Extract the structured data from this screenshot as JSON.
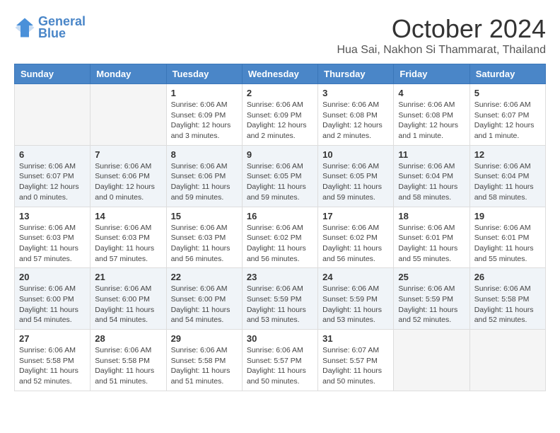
{
  "header": {
    "logo_line1": "General",
    "logo_line2": "Blue",
    "month_year": "October 2024",
    "location": "Hua Sai, Nakhon Si Thammarat, Thailand"
  },
  "weekdays": [
    "Sunday",
    "Monday",
    "Tuesday",
    "Wednesday",
    "Thursday",
    "Friday",
    "Saturday"
  ],
  "weeks": [
    [
      {
        "day": "",
        "info": ""
      },
      {
        "day": "",
        "info": ""
      },
      {
        "day": "1",
        "info": "Sunrise: 6:06 AM\nSunset: 6:09 PM\nDaylight: 12 hours\nand 3 minutes."
      },
      {
        "day": "2",
        "info": "Sunrise: 6:06 AM\nSunset: 6:09 PM\nDaylight: 12 hours\nand 2 minutes."
      },
      {
        "day": "3",
        "info": "Sunrise: 6:06 AM\nSunset: 6:08 PM\nDaylight: 12 hours\nand 2 minutes."
      },
      {
        "day": "4",
        "info": "Sunrise: 6:06 AM\nSunset: 6:08 PM\nDaylight: 12 hours\nand 1 minute."
      },
      {
        "day": "5",
        "info": "Sunrise: 6:06 AM\nSunset: 6:07 PM\nDaylight: 12 hours\nand 1 minute."
      }
    ],
    [
      {
        "day": "6",
        "info": "Sunrise: 6:06 AM\nSunset: 6:07 PM\nDaylight: 12 hours\nand 0 minutes."
      },
      {
        "day": "7",
        "info": "Sunrise: 6:06 AM\nSunset: 6:06 PM\nDaylight: 12 hours\nand 0 minutes."
      },
      {
        "day": "8",
        "info": "Sunrise: 6:06 AM\nSunset: 6:06 PM\nDaylight: 11 hours\nand 59 minutes."
      },
      {
        "day": "9",
        "info": "Sunrise: 6:06 AM\nSunset: 6:05 PM\nDaylight: 11 hours\nand 59 minutes."
      },
      {
        "day": "10",
        "info": "Sunrise: 6:06 AM\nSunset: 6:05 PM\nDaylight: 11 hours\nand 59 minutes."
      },
      {
        "day": "11",
        "info": "Sunrise: 6:06 AM\nSunset: 6:04 PM\nDaylight: 11 hours\nand 58 minutes."
      },
      {
        "day": "12",
        "info": "Sunrise: 6:06 AM\nSunset: 6:04 PM\nDaylight: 11 hours\nand 58 minutes."
      }
    ],
    [
      {
        "day": "13",
        "info": "Sunrise: 6:06 AM\nSunset: 6:03 PM\nDaylight: 11 hours\nand 57 minutes."
      },
      {
        "day": "14",
        "info": "Sunrise: 6:06 AM\nSunset: 6:03 PM\nDaylight: 11 hours\nand 57 minutes."
      },
      {
        "day": "15",
        "info": "Sunrise: 6:06 AM\nSunset: 6:03 PM\nDaylight: 11 hours\nand 56 minutes."
      },
      {
        "day": "16",
        "info": "Sunrise: 6:06 AM\nSunset: 6:02 PM\nDaylight: 11 hours\nand 56 minutes."
      },
      {
        "day": "17",
        "info": "Sunrise: 6:06 AM\nSunset: 6:02 PM\nDaylight: 11 hours\nand 56 minutes."
      },
      {
        "day": "18",
        "info": "Sunrise: 6:06 AM\nSunset: 6:01 PM\nDaylight: 11 hours\nand 55 minutes."
      },
      {
        "day": "19",
        "info": "Sunrise: 6:06 AM\nSunset: 6:01 PM\nDaylight: 11 hours\nand 55 minutes."
      }
    ],
    [
      {
        "day": "20",
        "info": "Sunrise: 6:06 AM\nSunset: 6:00 PM\nDaylight: 11 hours\nand 54 minutes."
      },
      {
        "day": "21",
        "info": "Sunrise: 6:06 AM\nSunset: 6:00 PM\nDaylight: 11 hours\nand 54 minutes."
      },
      {
        "day": "22",
        "info": "Sunrise: 6:06 AM\nSunset: 6:00 PM\nDaylight: 11 hours\nand 54 minutes."
      },
      {
        "day": "23",
        "info": "Sunrise: 6:06 AM\nSunset: 5:59 PM\nDaylight: 11 hours\nand 53 minutes."
      },
      {
        "day": "24",
        "info": "Sunrise: 6:06 AM\nSunset: 5:59 PM\nDaylight: 11 hours\nand 53 minutes."
      },
      {
        "day": "25",
        "info": "Sunrise: 6:06 AM\nSunset: 5:59 PM\nDaylight: 11 hours\nand 52 minutes."
      },
      {
        "day": "26",
        "info": "Sunrise: 6:06 AM\nSunset: 5:58 PM\nDaylight: 11 hours\nand 52 minutes."
      }
    ],
    [
      {
        "day": "27",
        "info": "Sunrise: 6:06 AM\nSunset: 5:58 PM\nDaylight: 11 hours\nand 52 minutes."
      },
      {
        "day": "28",
        "info": "Sunrise: 6:06 AM\nSunset: 5:58 PM\nDaylight: 11 hours\nand 51 minutes."
      },
      {
        "day": "29",
        "info": "Sunrise: 6:06 AM\nSunset: 5:58 PM\nDaylight: 11 hours\nand 51 minutes."
      },
      {
        "day": "30",
        "info": "Sunrise: 6:06 AM\nSunset: 5:57 PM\nDaylight: 11 hours\nand 50 minutes."
      },
      {
        "day": "31",
        "info": "Sunrise: 6:07 AM\nSunset: 5:57 PM\nDaylight: 11 hours\nand 50 minutes."
      },
      {
        "day": "",
        "info": ""
      },
      {
        "day": "",
        "info": ""
      }
    ]
  ]
}
